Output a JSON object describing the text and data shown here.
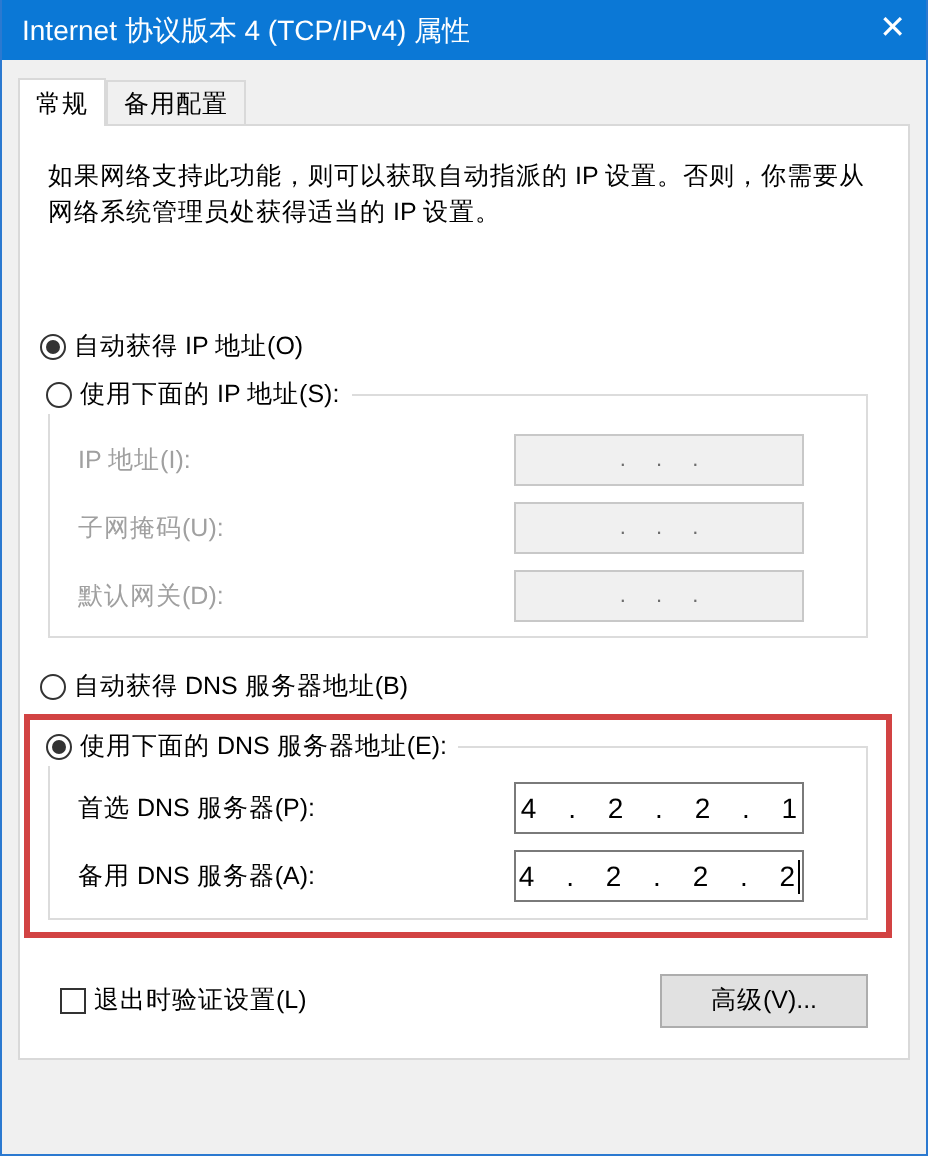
{
  "window": {
    "title": "Internet 协议版本 4 (TCP/IPv4) 属性",
    "close": "✕"
  },
  "tabs": [
    {
      "label": "常规",
      "selected": true
    },
    {
      "label": "备用配置",
      "selected": false
    }
  ],
  "description": "如果网络支持此功能，则可以获取自动指派的 IP 设置。否则，你需要从网络系统管理员处获得适当的 IP 设置。",
  "ip_auto": {
    "label": "自动获得 IP 地址(O)",
    "selected": true
  },
  "ip_manual": {
    "label": "使用下面的 IP 地址(S):",
    "selected": false,
    "fields": [
      {
        "label": "IP 地址(I):",
        "value": ". . .",
        "disabled": true
      },
      {
        "label": "子网掩码(U):",
        "value": ". . .",
        "disabled": true
      },
      {
        "label": "默认网关(D):",
        "value": ". . .",
        "disabled": true
      }
    ]
  },
  "dns_auto": {
    "label": "自动获得 DNS 服务器地址(B)",
    "selected": false
  },
  "dns_manual": {
    "label": "使用下面的 DNS 服务器地址(E):",
    "selected": true,
    "highlighted": true,
    "fields": [
      {
        "label": "首选 DNS 服务器(P):",
        "value": "4 . 2 . 2 . 1",
        "disabled": false,
        "caret": false
      },
      {
        "label": "备用 DNS 服务器(A):",
        "value": "4 . 2 . 2 . 2",
        "disabled": false,
        "caret": true
      }
    ]
  },
  "validate_checkbox": {
    "label": "退出时验证设置(L)",
    "checked": false
  },
  "advanced_button": "高级(V)..."
}
